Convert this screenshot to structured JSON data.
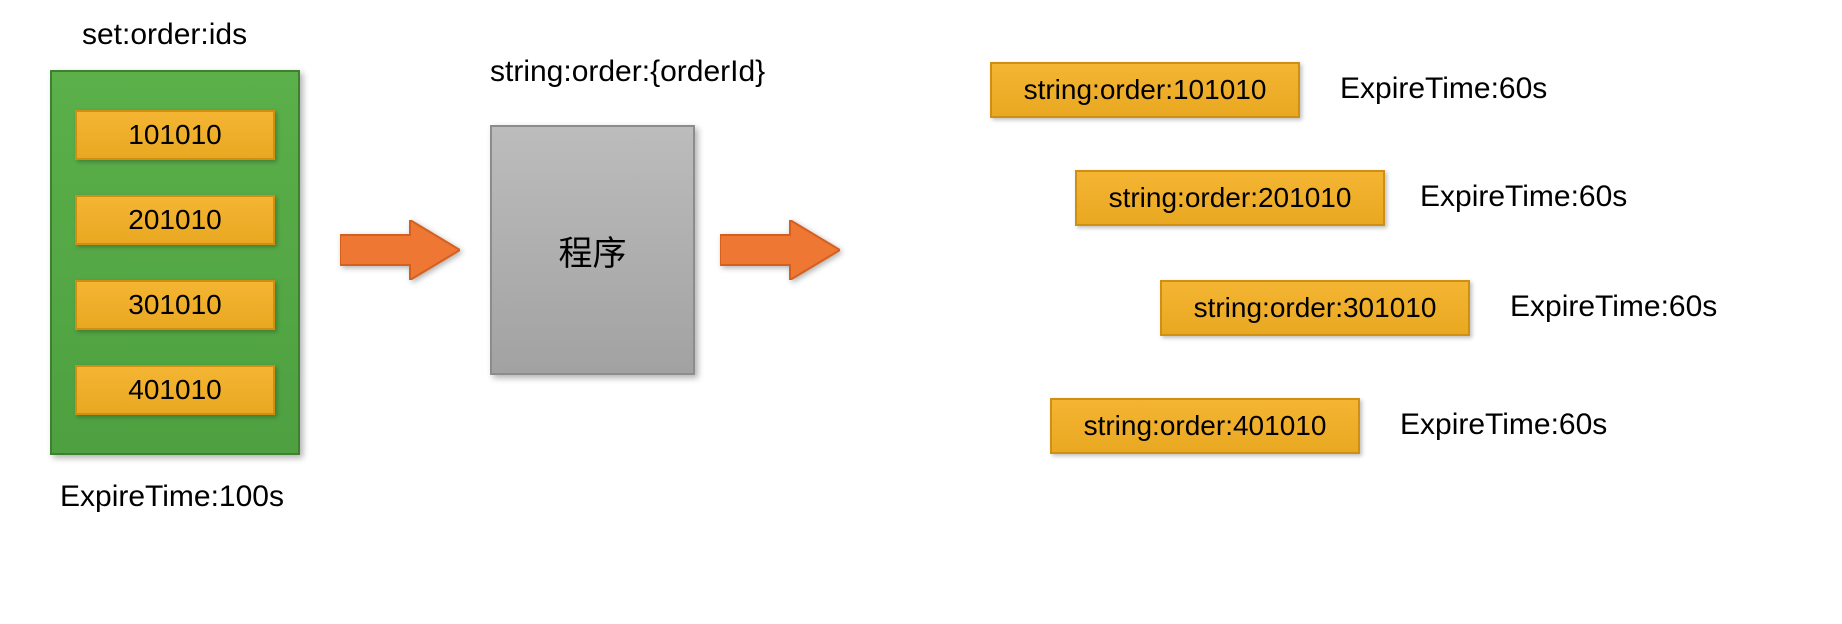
{
  "set": {
    "title": "set:order:ids",
    "items": [
      "101010",
      "201010",
      "301010",
      "401010"
    ],
    "expire_label": "ExpireTime:100s"
  },
  "string_template_title": "string:order:{orderId}",
  "program_label": "程序",
  "outputs": [
    {
      "key": "string:order:101010",
      "expire": "ExpireTime:60s"
    },
    {
      "key": "string:order:201010",
      "expire": "ExpireTime:60s"
    },
    {
      "key": "string:order:301010",
      "expire": "ExpireTime:60s"
    },
    {
      "key": "string:order:401010",
      "expire": "ExpireTime:60s"
    }
  ],
  "colors": {
    "green_box": "#4ea040",
    "yellow_box": "#e9a821",
    "gray_box": "#a2a2a2",
    "arrow": "#ed7733"
  }
}
